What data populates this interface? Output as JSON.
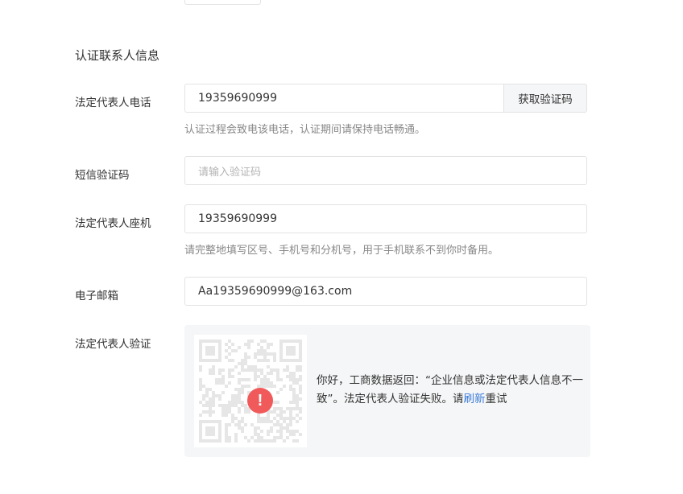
{
  "section": {
    "title": "认证联系人信息"
  },
  "form": {
    "rep_phone": {
      "label": "法定代表人电话",
      "value": "19359690999",
      "button_label": "获取验证码",
      "hint": "认证过程会致电该电话，认证期间请保持电话畅通。"
    },
    "sms_code": {
      "label": "短信验证码",
      "placeholder": "请输入验证码"
    },
    "rep_landline": {
      "label": "法定代表人座机",
      "value": "19359690999",
      "hint": "请完整地填写区号、手机号和分机号，用于手机联系不到你时备用。"
    },
    "email": {
      "label": "电子邮箱",
      "value": "Aa19359690999@163.com"
    },
    "rep_verify": {
      "label": "法定代表人验证",
      "icon": "alert-icon",
      "message_prefix": "你好，工商数据返回：“企业信息或法定代表人信息不一致”。法定代表人验证失败。请",
      "refresh_link": "刷新",
      "message_suffix": "重试"
    }
  },
  "colors": {
    "alert": "#f05a5a",
    "link": "#3b7bd8",
    "panel_bg": "#f5f6f7",
    "border": "#e3e3e3"
  }
}
